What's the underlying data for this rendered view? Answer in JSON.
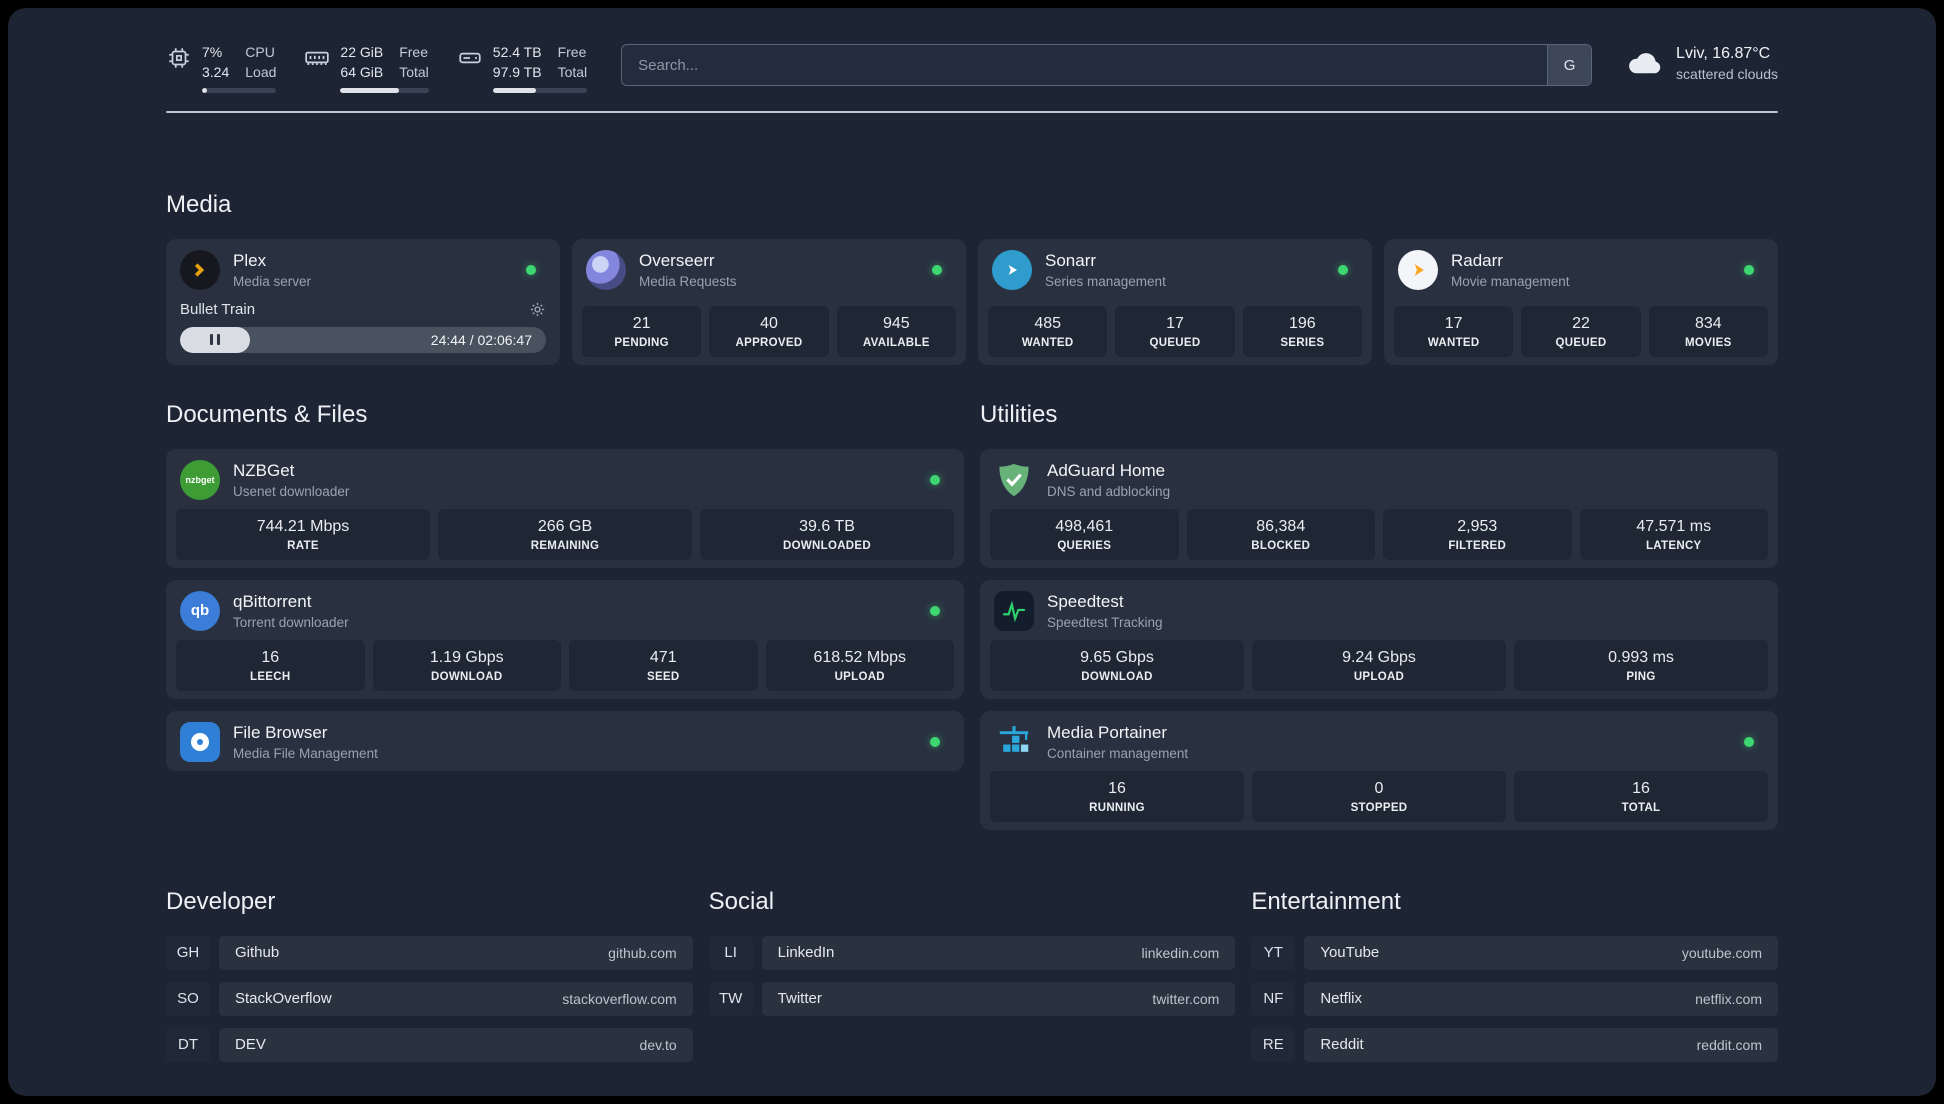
{
  "colors": {
    "status_green": "#3ed671",
    "plex_amber": "#e5a00d",
    "sonarr_blue": "#2f9ccd",
    "radarr_amber": "#f7a51d",
    "nzbget_green": "#3e9c35",
    "adguard_green": "#67b279",
    "qbittorrent_blue": "#3b7dd8",
    "speedtest_green": "#2dd36f",
    "filebrowser_blue": "#2f7fd6",
    "portainer_blue": "#2aa7dc"
  },
  "topbar": {
    "cpu": {
      "percent": "7%",
      "load": "3.24",
      "label1": "CPU",
      "label2": "Load",
      "progress": 7
    },
    "memory": {
      "free": "22 GiB",
      "total": "64 GiB",
      "label1": "Free",
      "label2": "Total",
      "progress": 66
    },
    "disk": {
      "free": "52.4 TB",
      "total": "97.9 TB",
      "label1": "Free",
      "label2": "Total",
      "progress": 46
    },
    "search": {
      "placeholder": "Search...",
      "button_label": "G"
    },
    "weather": {
      "location": "Lviv, 16.87°C",
      "condition": "scattered clouds"
    }
  },
  "sections": {
    "media": "Media",
    "documents": "Documents & Files",
    "utilities": "Utilities",
    "developer": "Developer",
    "social": "Social",
    "entertainment": "Entertainment"
  },
  "services": {
    "plex": {
      "name": "Plex",
      "subtitle": "Media server",
      "player": {
        "track": "Bullet Train",
        "time": "24:44 / 02:06:47",
        "progress": 19
      }
    },
    "overseerr": {
      "name": "Overseerr",
      "subtitle": "Media Requests",
      "stats": [
        {
          "value": "21",
          "label": "PENDING"
        },
        {
          "value": "40",
          "label": "APPROVED"
        },
        {
          "value": "945",
          "label": "AVAILABLE"
        }
      ]
    },
    "sonarr": {
      "name": "Sonarr",
      "subtitle": "Series management",
      "stats": [
        {
          "value": "485",
          "label": "WANTED"
        },
        {
          "value": "17",
          "label": "QUEUED"
        },
        {
          "value": "196",
          "label": "SERIES"
        }
      ]
    },
    "radarr": {
      "name": "Radarr",
      "subtitle": "Movie management",
      "stats": [
        {
          "value": "17",
          "label": "WANTED"
        },
        {
          "value": "22",
          "label": "QUEUED"
        },
        {
          "value": "834",
          "label": "MOVIES"
        }
      ]
    },
    "nzbget": {
      "name": "NZBGet",
      "subtitle": "Usenet downloader",
      "icon_text": "nzbget",
      "stats": [
        {
          "value": "744.21 Mbps",
          "label": "RATE"
        },
        {
          "value": "266 GB",
          "label": "REMAINING"
        },
        {
          "value": "39.6 TB",
          "label": "DOWNLOADED"
        }
      ]
    },
    "qbittorrent": {
      "name": "qBittorrent",
      "subtitle": "Torrent downloader",
      "icon_text": "qb",
      "stats": [
        {
          "value": "16",
          "label": "LEECH"
        },
        {
          "value": "1.19 Gbps",
          "label": "DOWNLOAD"
        },
        {
          "value": "471",
          "label": "SEED"
        },
        {
          "value": "618.52 Mbps",
          "label": "UPLOAD"
        }
      ]
    },
    "filebrowser": {
      "name": "File Browser",
      "subtitle": "Media File Management"
    },
    "adguard": {
      "name": "AdGuard Home",
      "subtitle": "DNS and adblocking",
      "stats": [
        {
          "value": "498,461",
          "label": "QUERIES"
        },
        {
          "value": "86,384",
          "label": "BLOCKED"
        },
        {
          "value": "2,953",
          "label": "FILTERED"
        },
        {
          "value": "47.571 ms",
          "label": "LATENCY"
        }
      ]
    },
    "speedtest": {
      "name": "Speedtest",
      "subtitle": "Speedtest Tracking",
      "stats": [
        {
          "value": "9.65 Gbps",
          "label": "DOWNLOAD"
        },
        {
          "value": "9.24 Gbps",
          "label": "UPLOAD"
        },
        {
          "value": "0.993 ms",
          "label": "PING"
        }
      ]
    },
    "portainer": {
      "name": "Media Portainer",
      "subtitle": "Container management",
      "stats": [
        {
          "value": "16",
          "label": "RUNNING"
        },
        {
          "value": "0",
          "label": "STOPPED"
        },
        {
          "value": "16",
          "label": "TOTAL"
        }
      ]
    }
  },
  "bookmarks": {
    "developer": [
      {
        "abbr": "GH",
        "name": "Github",
        "domain": "github.com"
      },
      {
        "abbr": "SO",
        "name": "StackOverflow",
        "domain": "stackoverflow.com"
      },
      {
        "abbr": "DT",
        "name": "DEV",
        "domain": "dev.to"
      }
    ],
    "social": [
      {
        "abbr": "LI",
        "name": "LinkedIn",
        "domain": "linkedin.com"
      },
      {
        "abbr": "TW",
        "name": "Twitter",
        "domain": "twitter.com"
      }
    ],
    "entertainment": [
      {
        "abbr": "YT",
        "name": "YouTube",
        "domain": "youtube.com"
      },
      {
        "abbr": "NF",
        "name": "Netflix",
        "domain": "netflix.com"
      },
      {
        "abbr": "RE",
        "name": "Reddit",
        "domain": "reddit.com"
      }
    ]
  }
}
